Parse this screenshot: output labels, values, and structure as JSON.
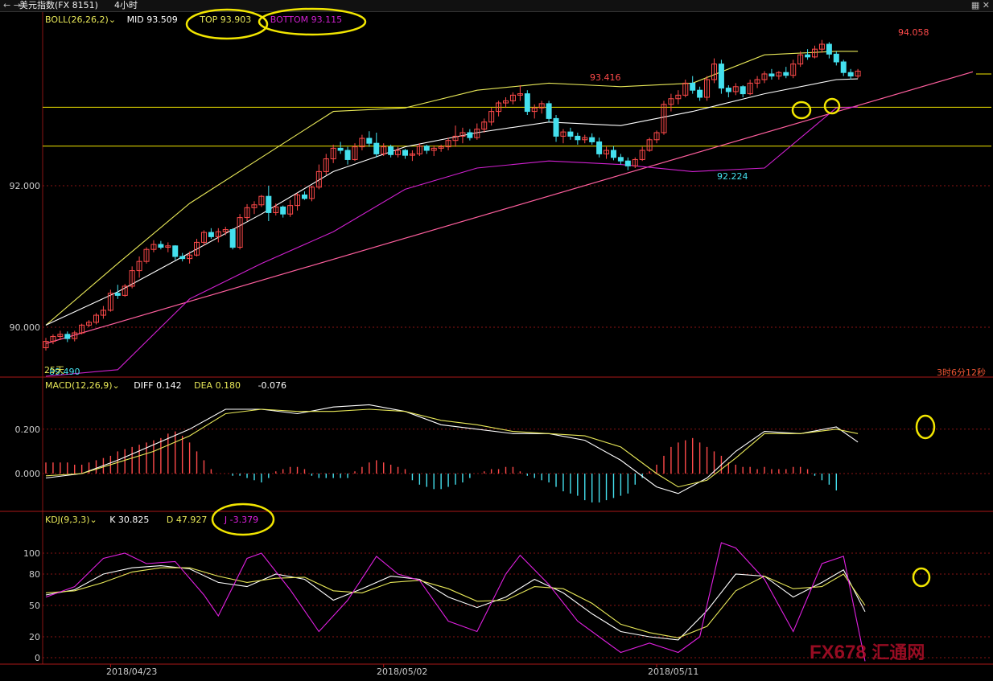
{
  "window": {
    "nav_icons": "← →",
    "instrument": "美元指数(FX 8151)",
    "period": "4小时",
    "tool_icons": "▦ ✕"
  },
  "colors": {
    "up": "#ff4a4a",
    "down": "#44e0ee",
    "mid": "#ffffff",
    "top": "#e8e858",
    "bottom": "#d020d0",
    "diff": "#ffffff",
    "dea": "#e8e858",
    "k": "#ffffff",
    "d": "#e8e858",
    "j": "#e020e0",
    "grid": "#8a1414",
    "ring": "#f2e600",
    "trendline": "#ff5f9e",
    "hline": "#f2e600"
  },
  "boll": {
    "label": "BOLL(26,26,2)",
    "mid": "MID 93.509",
    "top": "TOP 93.903",
    "bottom": "BOTTOM 93.115",
    "y_ticks": [
      "92.000",
      "90.000"
    ],
    "y_tick_values": [
      92,
      90
    ],
    "annotations": {
      "high1": "93.416",
      "high2": "94.058",
      "low": "92.224",
      "low_start": "89.490",
      "days": "25天"
    },
    "timer": "3时6分12秒"
  },
  "macd": {
    "label": "MACD(12,26,9)",
    "diff": "DIFF 0.142",
    "dea": "DEA 0.180",
    "hist": "-0.076",
    "y_ticks": [
      "0.200",
      "0.000"
    ],
    "y_tick_values": [
      0.2,
      0
    ]
  },
  "kdj": {
    "label": "KDJ(9,3,3)",
    "k": "K 30.825",
    "d": "D 47.927",
    "j": "J -3.379",
    "y_ticks": [
      "100",
      "80",
      "50",
      "20",
      "0"
    ],
    "y_tick_values": [
      100,
      80,
      50,
      20,
      0
    ]
  },
  "x_axis": {
    "labels": [
      "2018/04/23",
      "2018/05/02",
      "2018/05/11"
    ]
  },
  "watermark": {
    "latin": "FX678",
    "cn": "汇通网"
  },
  "chart_data": {
    "type": "candlestick",
    "title": "美元指数(FX 8151) 4小时",
    "y_range": [
      89.3,
      94.5
    ],
    "horizontal_levels": [
      93.11,
      92.56
    ],
    "trendline": [
      [
        0,
        89.77
      ],
      [
        129,
        93.61
      ]
    ],
    "date_labels": [
      {
        "index": 9,
        "label": "2018/04/23"
      },
      {
        "index": 47,
        "label": "2018/05/02"
      },
      {
        "index": 85,
        "label": "2018/05/11"
      }
    ],
    "candles": [
      [
        89.71,
        89.85,
        89.67,
        89.8
      ],
      [
        89.8,
        89.9,
        89.76,
        89.87
      ],
      [
        89.87,
        89.95,
        89.82,
        89.9
      ],
      [
        89.9,
        89.94,
        89.79,
        89.84
      ],
      [
        89.84,
        89.95,
        89.8,
        89.92
      ],
      [
        89.92,
        90.05,
        89.9,
        90.03
      ],
      [
        90.03,
        90.1,
        90.0,
        90.07
      ],
      [
        90.07,
        90.2,
        90.04,
        90.17
      ],
      [
        90.17,
        90.3,
        90.12,
        90.24
      ],
      [
        90.24,
        90.53,
        90.22,
        90.48
      ],
      [
        90.48,
        90.6,
        90.4,
        90.45
      ],
      [
        90.45,
        90.61,
        90.43,
        90.58
      ],
      [
        90.58,
        90.86,
        90.55,
        90.8
      ],
      [
        90.8,
        91.0,
        90.7,
        90.93
      ],
      [
        90.93,
        91.13,
        90.9,
        91.1
      ],
      [
        91.1,
        91.23,
        91.06,
        91.17
      ],
      [
        91.17,
        91.22,
        91.1,
        91.13
      ],
      [
        91.13,
        91.2,
        91.06,
        91.15
      ],
      [
        91.15,
        91.16,
        90.95,
        91.0
      ],
      [
        91.0,
        91.05,
        90.93,
        90.97
      ],
      [
        90.97,
        91.07,
        90.9,
        91.02
      ],
      [
        91.02,
        91.25,
        91.0,
        91.2
      ],
      [
        91.2,
        91.37,
        91.15,
        91.34
      ],
      [
        91.34,
        91.4,
        91.25,
        91.28
      ],
      [
        91.28,
        91.4,
        91.2,
        91.35
      ],
      [
        91.35,
        91.42,
        91.3,
        91.38
      ],
      [
        91.38,
        91.4,
        91.1,
        91.13
      ],
      [
        91.13,
        91.6,
        91.1,
        91.55
      ],
      [
        91.55,
        91.74,
        91.5,
        91.69
      ],
      [
        91.69,
        91.78,
        91.6,
        91.73
      ],
      [
        91.73,
        91.87,
        91.7,
        91.85
      ],
      [
        91.85,
        92.0,
        91.5,
        91.62
      ],
      [
        91.62,
        91.75,
        91.58,
        91.7
      ],
      [
        91.7,
        91.72,
        91.55,
        91.6
      ],
      [
        91.6,
        91.8,
        91.56,
        91.72
      ],
      [
        91.72,
        91.9,
        91.65,
        91.87
      ],
      [
        91.87,
        91.92,
        91.8,
        91.82
      ],
      [
        91.82,
        92.0,
        91.78,
        91.98
      ],
      [
        91.98,
        92.3,
        91.95,
        92.2
      ],
      [
        92.2,
        92.45,
        92.15,
        92.38
      ],
      [
        92.38,
        92.58,
        92.32,
        92.53
      ],
      [
        92.53,
        92.62,
        92.45,
        92.5
      ],
      [
        92.5,
        92.55,
        92.3,
        92.37
      ],
      [
        92.37,
        92.6,
        92.35,
        92.55
      ],
      [
        92.55,
        92.72,
        92.5,
        92.67
      ],
      [
        92.67,
        92.77,
        92.55,
        92.6
      ],
      [
        92.6,
        92.75,
        92.4,
        92.45
      ],
      [
        92.45,
        92.6,
        92.42,
        92.55
      ],
      [
        92.55,
        92.58,
        92.4,
        92.44
      ],
      [
        92.44,
        92.55,
        92.4,
        92.5
      ],
      [
        92.5,
        92.52,
        92.38,
        92.43
      ],
      [
        92.43,
        92.5,
        92.35,
        92.45
      ],
      [
        92.45,
        92.6,
        92.42,
        92.56
      ],
      [
        92.56,
        92.58,
        92.45,
        92.5
      ],
      [
        92.5,
        92.57,
        92.42,
        92.53
      ],
      [
        92.53,
        92.58,
        92.48,
        92.55
      ],
      [
        92.55,
        92.68,
        92.5,
        92.64
      ],
      [
        92.64,
        92.85,
        92.55,
        92.7
      ],
      [
        92.7,
        92.82,
        92.6,
        92.75
      ],
      [
        92.75,
        92.8,
        92.64,
        92.68
      ],
      [
        92.68,
        92.88,
        92.65,
        92.8
      ],
      [
        92.8,
        92.95,
        92.75,
        92.9
      ],
      [
        92.9,
        93.1,
        92.85,
        93.05
      ],
      [
        93.05,
        93.2,
        92.98,
        93.17
      ],
      [
        93.17,
        93.25,
        93.1,
        93.2
      ],
      [
        93.2,
        93.32,
        93.15,
        93.28
      ],
      [
        93.28,
        93.42,
        93.2,
        93.3
      ],
      [
        93.3,
        93.35,
        93.0,
        93.05
      ],
      [
        93.05,
        93.15,
        92.95,
        93.1
      ],
      [
        93.1,
        93.2,
        93.02,
        93.16
      ],
      [
        93.16,
        93.2,
        92.9,
        92.95
      ],
      [
        92.95,
        93.0,
        92.62,
        92.7
      ],
      [
        92.7,
        92.8,
        92.6,
        92.76
      ],
      [
        92.76,
        92.82,
        92.65,
        92.7
      ],
      [
        92.7,
        92.75,
        92.58,
        92.65
      ],
      [
        92.65,
        92.72,
        92.6,
        92.68
      ],
      [
        92.68,
        92.74,
        92.58,
        92.62
      ],
      [
        92.62,
        92.68,
        92.4,
        92.45
      ],
      [
        92.45,
        92.55,
        92.38,
        92.5
      ],
      [
        92.5,
        92.56,
        92.36,
        92.4
      ],
      [
        92.4,
        92.45,
        92.3,
        92.35
      ],
      [
        92.35,
        92.4,
        92.22,
        92.28
      ],
      [
        92.28,
        92.4,
        92.25,
        92.37
      ],
      [
        92.37,
        92.55,
        92.35,
        92.5
      ],
      [
        92.5,
        92.68,
        92.48,
        92.65
      ],
      [
        92.65,
        92.78,
        92.6,
        92.75
      ],
      [
        92.75,
        93.2,
        92.72,
        93.15
      ],
      [
        93.15,
        93.3,
        93.05,
        93.23
      ],
      [
        93.23,
        93.35,
        93.15,
        93.28
      ],
      [
        93.28,
        93.5,
        93.25,
        93.45
      ],
      [
        93.45,
        93.55,
        93.3,
        93.35
      ],
      [
        93.35,
        93.4,
        93.2,
        93.25
      ],
      [
        93.25,
        93.55,
        93.2,
        93.5
      ],
      [
        93.5,
        93.8,
        93.45,
        93.72
      ],
      [
        93.72,
        93.78,
        93.3,
        93.38
      ],
      [
        93.38,
        93.42,
        93.25,
        93.33
      ],
      [
        93.33,
        93.45,
        93.28,
        93.4
      ],
      [
        93.4,
        93.42,
        93.25,
        93.3
      ],
      [
        93.3,
        93.5,
        93.28,
        93.45
      ],
      [
        93.45,
        93.55,
        93.38,
        93.5
      ],
      [
        93.5,
        93.62,
        93.45,
        93.58
      ],
      [
        93.58,
        93.65,
        93.5,
        93.55
      ],
      [
        93.55,
        93.62,
        93.5,
        93.6
      ],
      [
        93.6,
        93.68,
        93.52,
        93.56
      ],
      [
        93.56,
        93.78,
        93.52,
        93.72
      ],
      [
        93.72,
        93.9,
        93.68,
        93.85
      ],
      [
        93.85,
        93.93,
        93.78,
        93.82
      ],
      [
        93.82,
        93.98,
        93.8,
        93.93
      ],
      [
        93.93,
        94.06,
        93.88,
        94.0
      ],
      [
        94.0,
        94.03,
        93.8,
        93.86
      ],
      [
        93.86,
        93.9,
        93.7,
        93.75
      ],
      [
        93.75,
        93.78,
        93.55,
        93.6
      ],
      [
        93.6,
        93.65,
        93.5,
        93.55
      ],
      [
        93.55,
        93.65,
        93.52,
        93.62
      ]
    ],
    "boll_mid": [
      [
        0,
        90.03
      ],
      [
        10,
        90.5
      ],
      [
        20,
        91.05
      ],
      [
        30,
        91.6
      ],
      [
        40,
        92.2
      ],
      [
        50,
        92.55
      ],
      [
        60,
        92.75
      ],
      [
        70,
        92.9
      ],
      [
        80,
        92.85
      ],
      [
        90,
        93.05
      ],
      [
        100,
        93.3
      ],
      [
        110,
        93.5
      ],
      [
        113,
        93.51
      ]
    ],
    "boll_top": [
      [
        0,
        90.03
      ],
      [
        10,
        90.9
      ],
      [
        20,
        91.75
      ],
      [
        30,
        92.4
      ],
      [
        40,
        93.05
      ],
      [
        50,
        93.1
      ],
      [
        60,
        93.35
      ],
      [
        70,
        93.45
      ],
      [
        80,
        93.4
      ],
      [
        90,
        93.45
      ],
      [
        100,
        93.85
      ],
      [
        110,
        93.9
      ],
      [
        113,
        93.9
      ]
    ],
    "boll_bottom": [
      [
        0,
        89.22
      ],
      [
        10,
        89.4
      ],
      [
        20,
        90.4
      ],
      [
        30,
        90.9
      ],
      [
        40,
        91.35
      ],
      [
        50,
        91.95
      ],
      [
        60,
        92.25
      ],
      [
        70,
        92.35
      ],
      [
        80,
        92.3
      ],
      [
        90,
        92.2
      ],
      [
        100,
        92.25
      ],
      [
        110,
        93.1
      ],
      [
        113,
        93.115
      ]
    ],
    "macd_diff": [
      [
        0,
        -0.02
      ],
      [
        5,
        0.0
      ],
      [
        10,
        0.06
      ],
      [
        15,
        0.13
      ],
      [
        20,
        0.2
      ],
      [
        25,
        0.29
      ],
      [
        30,
        0.29
      ],
      [
        35,
        0.27
      ],
      [
        40,
        0.3
      ],
      [
        45,
        0.31
      ],
      [
        50,
        0.28
      ],
      [
        55,
        0.22
      ],
      [
        60,
        0.2
      ],
      [
        65,
        0.18
      ],
      [
        70,
        0.18
      ],
      [
        75,
        0.15
      ],
      [
        80,
        0.06
      ],
      [
        85,
        -0.06
      ],
      [
        88,
        -0.09
      ],
      [
        92,
        -0.02
      ],
      [
        96,
        0.1
      ],
      [
        100,
        0.19
      ],
      [
        105,
        0.18
      ],
      [
        110,
        0.21
      ],
      [
        113,
        0.142
      ]
    ],
    "macd_dea": [
      [
        0,
        -0.01
      ],
      [
        5,
        0.0
      ],
      [
        10,
        0.05
      ],
      [
        15,
        0.1
      ],
      [
        20,
        0.17
      ],
      [
        25,
        0.27
      ],
      [
        30,
        0.29
      ],
      [
        35,
        0.28
      ],
      [
        40,
        0.28
      ],
      [
        45,
        0.29
      ],
      [
        50,
        0.28
      ],
      [
        55,
        0.24
      ],
      [
        60,
        0.22
      ],
      [
        65,
        0.19
      ],
      [
        70,
        0.18
      ],
      [
        75,
        0.17
      ],
      [
        80,
        0.12
      ],
      [
        85,
        0.0
      ],
      [
        88,
        -0.06
      ],
      [
        92,
        -0.03
      ],
      [
        96,
        0.07
      ],
      [
        100,
        0.18
      ],
      [
        105,
        0.18
      ],
      [
        110,
        0.2
      ],
      [
        113,
        0.18
      ]
    ],
    "macd_hist": [
      0.05,
      0.05,
      0.05,
      0.05,
      0.04,
      0.04,
      0.05,
      0.06,
      0.07,
      0.08,
      0.1,
      0.11,
      0.12,
      0.13,
      0.14,
      0.15,
      0.16,
      0.18,
      0.19,
      0.17,
      0.14,
      0.1,
      0.06,
      0.02,
      0.0,
      0.0,
      -0.01,
      -0.01,
      -0.02,
      -0.03,
      -0.04,
      -0.02,
      0.01,
      0.02,
      0.03,
      0.03,
      0.02,
      -0.01,
      -0.02,
      -0.02,
      -0.02,
      -0.02,
      -0.02,
      0.01,
      0.03,
      0.05,
      0.06,
      0.05,
      0.04,
      0.03,
      0.02,
      -0.03,
      -0.05,
      -0.06,
      -0.07,
      -0.07,
      -0.06,
      -0.05,
      -0.04,
      -0.02,
      0.0,
      0.01,
      0.02,
      0.02,
      0.03,
      0.03,
      0.01,
      -0.01,
      -0.02,
      -0.03,
      -0.04,
      -0.06,
      -0.08,
      -0.09,
      -0.1,
      -0.12,
      -0.13,
      -0.13,
      -0.12,
      -0.11,
      -0.1,
      -0.09,
      -0.05,
      -0.02,
      0.01,
      0.04,
      0.08,
      0.12,
      0.14,
      0.15,
      0.16,
      0.14,
      0.12,
      0.1,
      0.08,
      0.05,
      0.04,
      0.03,
      0.03,
      0.02,
      0.03,
      0.02,
      0.02,
      0.02,
      0.03,
      0.03,
      0.02,
      -0.01,
      -0.03,
      -0.05,
      -0.076
    ],
    "kdj_k": [
      [
        0,
        60
      ],
      [
        4,
        65
      ],
      [
        8,
        80
      ],
      [
        12,
        86
      ],
      [
        16,
        88
      ],
      [
        20,
        85
      ],
      [
        24,
        72
      ],
      [
        28,
        68
      ],
      [
        32,
        80
      ],
      [
        36,
        75
      ],
      [
        40,
        55
      ],
      [
        44,
        66
      ],
      [
        48,
        78
      ],
      [
        52,
        75
      ],
      [
        56,
        58
      ],
      [
        60,
        48
      ],
      [
        64,
        58
      ],
      [
        68,
        75
      ],
      [
        72,
        62
      ],
      [
        76,
        42
      ],
      [
        80,
        25
      ],
      [
        84,
        20
      ],
      [
        88,
        17
      ],
      [
        92,
        45
      ],
      [
        96,
        80
      ],
      [
        100,
        78
      ],
      [
        104,
        58
      ],
      [
        108,
        72
      ],
      [
        111,
        84
      ],
      [
        114,
        44
      ]
    ],
    "kdj_d": [
      [
        0,
        62
      ],
      [
        4,
        64
      ],
      [
        8,
        72
      ],
      [
        12,
        82
      ],
      [
        16,
        86
      ],
      [
        20,
        86
      ],
      [
        24,
        78
      ],
      [
        28,
        72
      ],
      [
        32,
        76
      ],
      [
        36,
        77
      ],
      [
        40,
        64
      ],
      [
        44,
        62
      ],
      [
        48,
        72
      ],
      [
        52,
        74
      ],
      [
        56,
        66
      ],
      [
        60,
        54
      ],
      [
        64,
        55
      ],
      [
        68,
        68
      ],
      [
        72,
        66
      ],
      [
        76,
        52
      ],
      [
        80,
        32
      ],
      [
        84,
        24
      ],
      [
        88,
        19
      ],
      [
        92,
        30
      ],
      [
        96,
        64
      ],
      [
        100,
        78
      ],
      [
        104,
        66
      ],
      [
        108,
        68
      ],
      [
        111,
        80
      ],
      [
        114,
        50
      ]
    ],
    "kdj_j": [
      [
        0,
        58
      ],
      [
        4,
        68
      ],
      [
        8,
        95
      ],
      [
        11,
        100
      ],
      [
        14,
        90
      ],
      [
        18,
        92
      ],
      [
        22,
        60
      ],
      [
        24,
        40
      ],
      [
        28,
        95
      ],
      [
        30,
        100
      ],
      [
        34,
        65
      ],
      [
        38,
        25
      ],
      [
        42,
        55
      ],
      [
        46,
        97
      ],
      [
        49,
        80
      ],
      [
        52,
        74
      ],
      [
        56,
        35
      ],
      [
        60,
        25
      ],
      [
        64,
        80
      ],
      [
        66,
        98
      ],
      [
        70,
        70
      ],
      [
        74,
        35
      ],
      [
        78,
        15
      ],
      [
        80,
        5
      ],
      [
        84,
        14
      ],
      [
        88,
        5
      ],
      [
        91,
        20
      ],
      [
        94,
        110
      ],
      [
        96,
        105
      ],
      [
        100,
        75
      ],
      [
        104,
        25
      ],
      [
        108,
        90
      ],
      [
        111,
        97
      ],
      [
        114,
        -3.379
      ]
    ]
  }
}
